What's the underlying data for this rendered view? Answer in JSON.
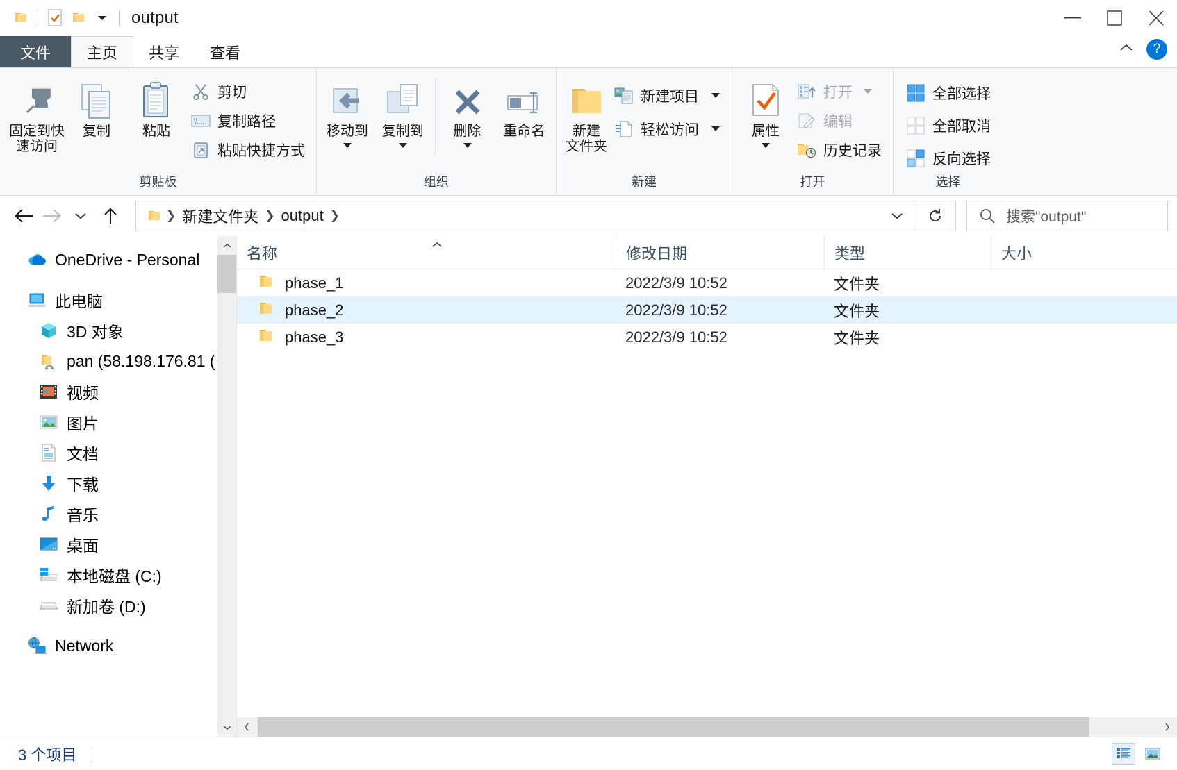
{
  "window": {
    "title": "output",
    "quick_access_icons": [
      "folder-icon",
      "properties-icon",
      "folder-icon",
      "chevron-down-icon"
    ],
    "controls": {
      "minimize": "minimize-button",
      "maximize": "maximize-button",
      "close": "close-button"
    }
  },
  "tabs": [
    {
      "key": "file",
      "label": "文件"
    },
    {
      "key": "home",
      "label": "主页"
    },
    {
      "key": "share",
      "label": "共享"
    },
    {
      "key": "view",
      "label": "查看"
    }
  ],
  "tab_active": "主页",
  "ribbon_right": {
    "collapse": "chevron-up-icon",
    "help": "?"
  },
  "ribbon": {
    "groups": [
      {
        "name": "clipboard",
        "label": "剪贴板",
        "big_buttons": [
          {
            "label": "固定到快速访问",
            "icon": "pin-icon",
            "lines": [
              "固定到快",
              "速访问"
            ]
          },
          {
            "label": "复制",
            "icon": "copy-icon",
            "lines": [
              "复制"
            ]
          },
          {
            "label": "粘贴",
            "icon": "paste-icon",
            "lines": [
              "粘贴"
            ]
          }
        ],
        "small_buttons": [
          {
            "label": "剪切",
            "icon": "scissors-icon",
            "disabled": true
          },
          {
            "label": "复制路径",
            "icon": "copy-path-icon",
            "disabled": true
          },
          {
            "label": "粘贴快捷方式",
            "icon": "paste-shortcut-icon",
            "disabled": true
          }
        ]
      },
      {
        "name": "organize",
        "label": "组织",
        "big_buttons": [
          {
            "label": "移动到",
            "icon": "move-to-icon",
            "lines": [
              "移动到"
            ],
            "dropdown": true
          },
          {
            "label": "复制到",
            "icon": "copy-to-icon",
            "lines": [
              "复制到"
            ],
            "dropdown": true
          },
          {
            "label": "删除",
            "icon": "delete-icon",
            "lines": [
              "删除"
            ],
            "dropdown": true
          },
          {
            "label": "重命名",
            "icon": "rename-icon",
            "lines": [
              "重命名"
            ]
          }
        ],
        "small_buttons": []
      },
      {
        "name": "new",
        "label": "新建",
        "big_buttons": [
          {
            "label": "新建文件夹",
            "icon": "new-folder-icon",
            "lines": [
              "新建",
              "文件夹"
            ]
          }
        ],
        "small_buttons": [
          {
            "label": "新建项目",
            "icon": "new-item-icon",
            "dropdown": true
          },
          {
            "label": "轻松访问",
            "icon": "easy-access-icon",
            "dropdown": true
          }
        ]
      },
      {
        "name": "open",
        "label": "打开",
        "big_buttons": [
          {
            "label": "属性",
            "icon": "properties-icon",
            "lines": [
              "属性"
            ],
            "dropdown": true
          }
        ],
        "small_buttons": [
          {
            "label": "打开",
            "icon": "open-icon",
            "dropdown": true,
            "disabled": true
          },
          {
            "label": "编辑",
            "icon": "edit-icon",
            "disabled": true
          },
          {
            "label": "历史记录",
            "icon": "history-icon"
          }
        ]
      },
      {
        "name": "select",
        "label": "选择",
        "big_buttons": [],
        "small_buttons": [
          {
            "label": "全部选择",
            "icon": "select-all-icon"
          },
          {
            "label": "全部取消",
            "icon": "select-none-icon"
          },
          {
            "label": "反向选择",
            "icon": "invert-selection-icon"
          }
        ]
      }
    ]
  },
  "addressbar": {
    "back": "back-arrow-icon",
    "forward": "forward-arrow-icon",
    "recent": "chevron-down-icon",
    "up": "up-arrow-icon",
    "breadcrumbs": [
      "新建文件夹",
      "output"
    ],
    "dropdown": "chevron-down-icon",
    "refresh": "refresh-icon",
    "search": {
      "placeholder": "搜索\"output\"",
      "icon": "search-icon"
    }
  },
  "navpane": {
    "items": [
      {
        "label": "OneDrive - Personal",
        "icon": "onedrive-icon",
        "level": 1
      },
      {
        "label": "此电脑",
        "icon": "this-pc-icon",
        "level": 1
      },
      {
        "label": "3D 对象",
        "icon": "3d-objects-icon",
        "level": 2
      },
      {
        "label": "pan (58.198.176.81 (",
        "icon": "network-folder-icon",
        "level": 2
      },
      {
        "label": "视频",
        "icon": "videos-icon",
        "level": 2
      },
      {
        "label": "图片",
        "icon": "pictures-icon",
        "level": 2
      },
      {
        "label": "文档",
        "icon": "documents-icon",
        "level": 2
      },
      {
        "label": "下载",
        "icon": "downloads-icon",
        "level": 2
      },
      {
        "label": "音乐",
        "icon": "music-icon",
        "level": 2
      },
      {
        "label": "桌面",
        "icon": "desktop-icon",
        "level": 2
      },
      {
        "label": "本地磁盘 (C:)",
        "icon": "local-disk-icon",
        "level": 2
      },
      {
        "label": "新加卷 (D:)",
        "icon": "drive-icon",
        "level": 2
      },
      {
        "label": "Network",
        "icon": "network-icon",
        "level": 1
      }
    ]
  },
  "filelist": {
    "columns": [
      {
        "key": "name",
        "label": "名称",
        "sorted": true,
        "sort_dir": "asc"
      },
      {
        "key": "date",
        "label": "修改日期"
      },
      {
        "key": "type",
        "label": "类型"
      },
      {
        "key": "size",
        "label": "大小"
      }
    ],
    "rows": [
      {
        "name": "phase_1",
        "date": "2022/3/9 10:52",
        "type": "文件夹",
        "size": "",
        "icon": "folder-icon",
        "selected": false
      },
      {
        "name": "phase_2",
        "date": "2022/3/9 10:52",
        "type": "文件夹",
        "size": "",
        "icon": "folder-icon",
        "selected": true
      },
      {
        "name": "phase_3",
        "date": "2022/3/9 10:52",
        "type": "文件夹",
        "size": "",
        "icon": "folder-icon",
        "selected": false
      }
    ]
  },
  "statusbar": {
    "item_count": "3 个项目",
    "views": [
      {
        "key": "details",
        "icon": "details-view-icon",
        "active": true
      },
      {
        "key": "large",
        "icon": "large-icons-view-icon",
        "active": false
      }
    ]
  },
  "colors": {
    "accent": "#0078d7",
    "selection": "#cce8ff",
    "file_tab": "#4a5764",
    "ribbon_bg": "#f7f9fa",
    "folder_yellow": "#ffd983",
    "status_text": "#1a3a6b"
  }
}
